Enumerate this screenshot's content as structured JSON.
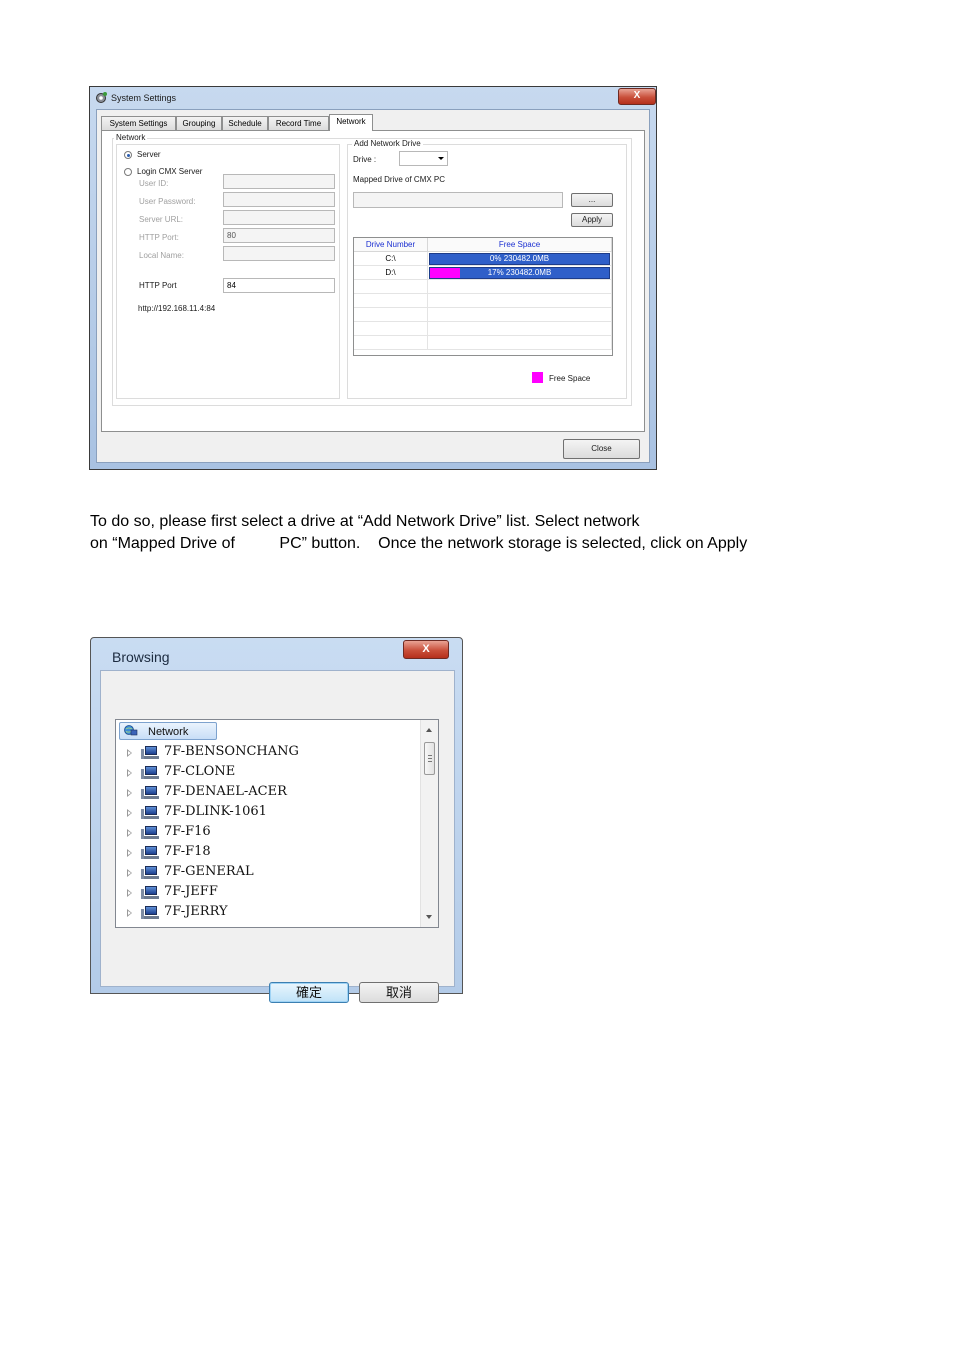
{
  "settings_window": {
    "title": "System Settings",
    "tabs": [
      "System Settings",
      "Grouping",
      "Schedule",
      "Record Time",
      "Network"
    ],
    "active_tab": "Network",
    "network_group_label": "Network",
    "server_radio": "Server",
    "login_radio": "Login CMX Server",
    "login_fields": {
      "user_id": "User ID:",
      "user_password": "User Password:",
      "server_url": "Server URL:",
      "http_port_label": "HTTP Port:",
      "http_port_value": "80",
      "local_name": "Local Name:"
    },
    "http_port_label": "HTTP Port",
    "http_port_value": "84",
    "server_url_text": "http://192.168.11.4:84",
    "add_drive_group_label": "Add Network Drive",
    "drive_label": "Drive :",
    "drive_value": "",
    "mapped_drive_label": "Mapped Drive of CMX PC",
    "mapped_drive_value": "",
    "browse_button": "...",
    "apply_button": "Apply",
    "grid_headers": [
      "Drive Number",
      "Free Space"
    ],
    "drives": [
      {
        "drive": "C:\\",
        "used_percent": 0,
        "text": "0%   230482.0MB"
      },
      {
        "drive": "D:\\",
        "used_percent": 17,
        "text": "17%   230482.0MB"
      }
    ],
    "legend_label": "Free Space",
    "legend_color": "#ff00ff",
    "bar_color": "#2f5fc9",
    "close_button": "Close",
    "close_x": "X"
  },
  "instructions": {
    "line1": "To do so, please first select a drive at “Add Network Drive” list.    Select network",
    "line2": "on “Mapped Drive of          PC” button.    Once the network storage is selected, click on Apply"
  },
  "browse_window": {
    "title": "Browsing",
    "close_x": "X",
    "root": "Network",
    "nodes": [
      "7F-BENSONCHANG",
      "7F-CLONE",
      "7F-DENAEL-ACER",
      "7F-DLINK-1061",
      "7F-F16",
      "7F-F18",
      "7F-GENERAL",
      "7F-JEFF",
      "7F-JERRY"
    ],
    "ok_button": "確定",
    "cancel_button": "取消"
  }
}
